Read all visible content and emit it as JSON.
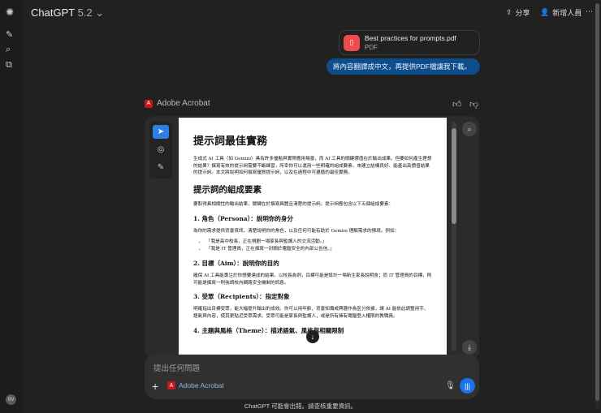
{
  "header": {
    "app": "ChatGPT",
    "version": "5.2",
    "share": "分享",
    "add_people": "新增人員",
    "more": "⋯"
  },
  "user": {
    "avatar": "SV"
  },
  "message": {
    "file_name": "Best practices for prompts.pdf",
    "file_type": "PDF",
    "text": "將內容翻譯成中文，再提供PDF檔讓我下載。"
  },
  "acrobat": {
    "label": "Adobe Acrobat"
  },
  "document": {
    "title": "提示詞最佳實務",
    "intro": "生成式 AI 工具（如 Gemini）具有許多優點與實際應用場景，而 AI 工具的關鍵價值在於輸出成果。但要如何產生理想的結果？撰寫有效的提示詞需要不斷練習，所幸你可以運用一些明確的組成要素，來建立結構良好、能產出高價值結果的提示詞。本文將說明如何撰寫優質提示詞，以及在過程中可遵循的最佳實務。",
    "section": "提示詞的組成要素",
    "section_intro": "要取得具相關性的輸出結果，關鍵在於撰寫具體且清楚的提示詞。提示詞應包含以下五個組成要素：",
    "h1": "1. 角色（Persona）：說明你的身分",
    "p1": "為你的需求提供背景資訊，清楚說明你的角色，以及任何可能有助於 Gemini 理解需求的情境。例如：",
    "bullets": [
      "「我是高中校長，正在規劃一場家長與監護人的交流活動。」",
      "「我是 IT 管理員，正在撰寫一封關於電腦安全的內部公告信。」"
    ],
    "h2": "2. 目標（Aim）：說明你的目的",
    "p2": "確保 AI 工具能專注於你想要達成的結果。以校長為例，目標可能是設計一場新生家長說明會；而 IT 管理員的目標，則可能是撰寫一則強調校內網路安全機制的訊息。",
    "h3": "3. 受眾（Recipients）：指定對象",
    "p3": "明確指出目標受眾，能大幅提升輸出的成效。你可以用年齡、背景知識或興趣作為區分依據，讓 AI 能依此調整用字、語氣與內容，使其更貼近受眾需求。受眾可能是家長與監護人，或是所有擁有電腦登入權限的教職員。",
    "h4": "4. 主題與風格（Theme）：描述語氣、風格與相關限制"
  },
  "composer": {
    "placeholder": "提出任何問題",
    "tool_chip": "Adobe Acrobat"
  },
  "footer": "ChatGPT 可能會出錯。請查核重要資訊。"
}
